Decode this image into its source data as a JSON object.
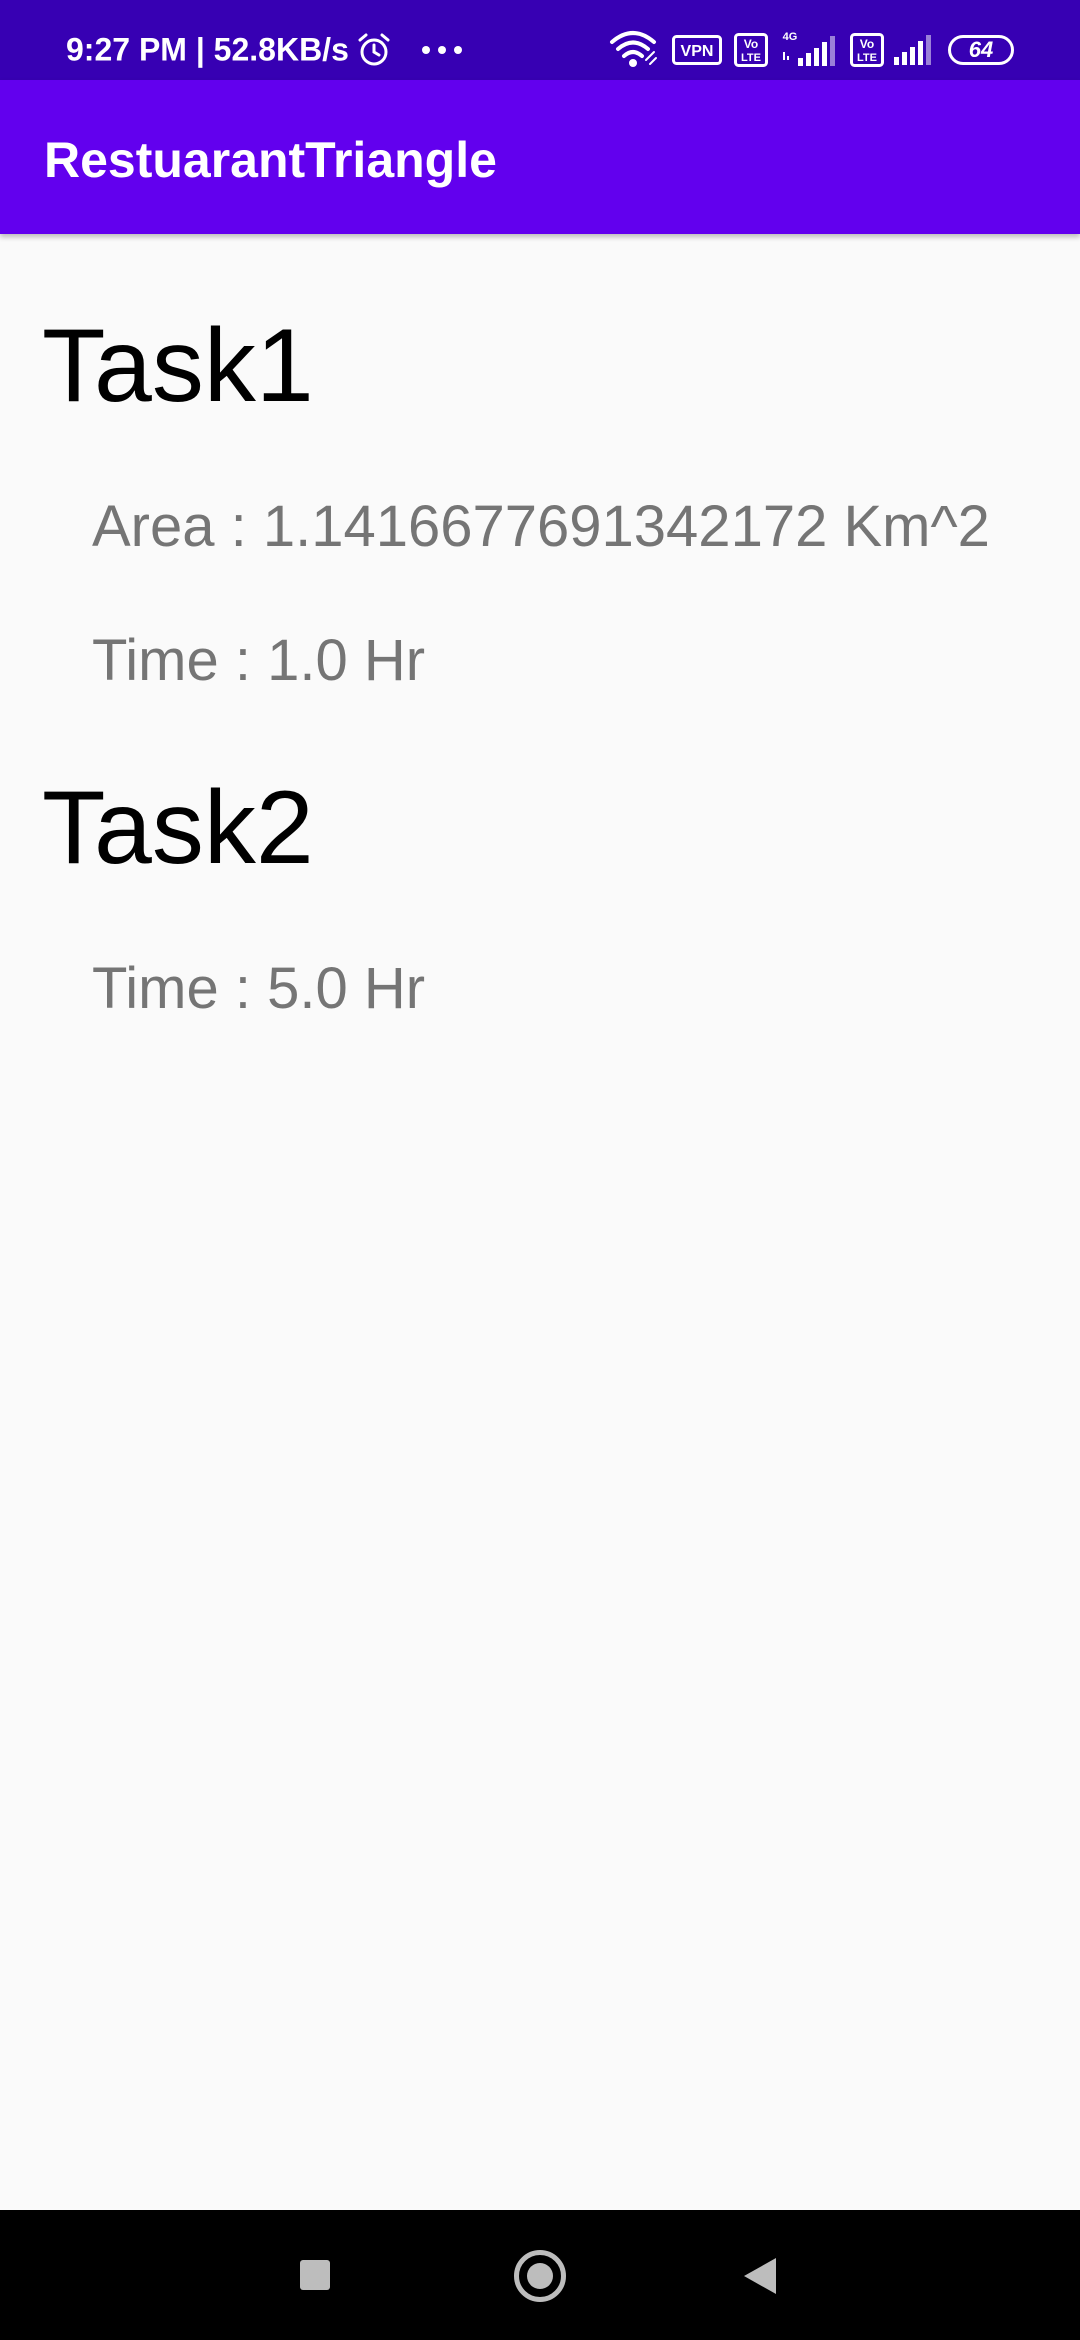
{
  "status_bar": {
    "time": "9:27 PM | 52.8KB/s",
    "icons": [
      "alarm-icon",
      "more-dots-icon",
      "wifi-icon",
      "vpn-icon",
      "volte-icon",
      "signal-4g-icon",
      "volte-icon",
      "signal-icon"
    ],
    "vpn_label": "VPN",
    "volte_label_top": "Vo",
    "volte_label_bottom": "LTE",
    "network_label": "4G",
    "battery": "64"
  },
  "app_bar": {
    "title": "RestuarantTriangle"
  },
  "content": {
    "task1": {
      "heading": "Task1",
      "area": "Area : 1.1416677691342172 Km^2",
      "time": "Time : 1.0 Hr"
    },
    "task2": {
      "heading": "Task2",
      "time": "Time : 5.0 Hr"
    }
  },
  "nav_bar": {
    "icons": [
      "recent-apps-icon",
      "home-icon",
      "back-icon"
    ]
  },
  "colors": {
    "status_bar": "#3700b3",
    "app_bar": "#6200ee",
    "background": "#fafafa",
    "secondary_text": "#757575",
    "nav_bar": "#000000"
  }
}
